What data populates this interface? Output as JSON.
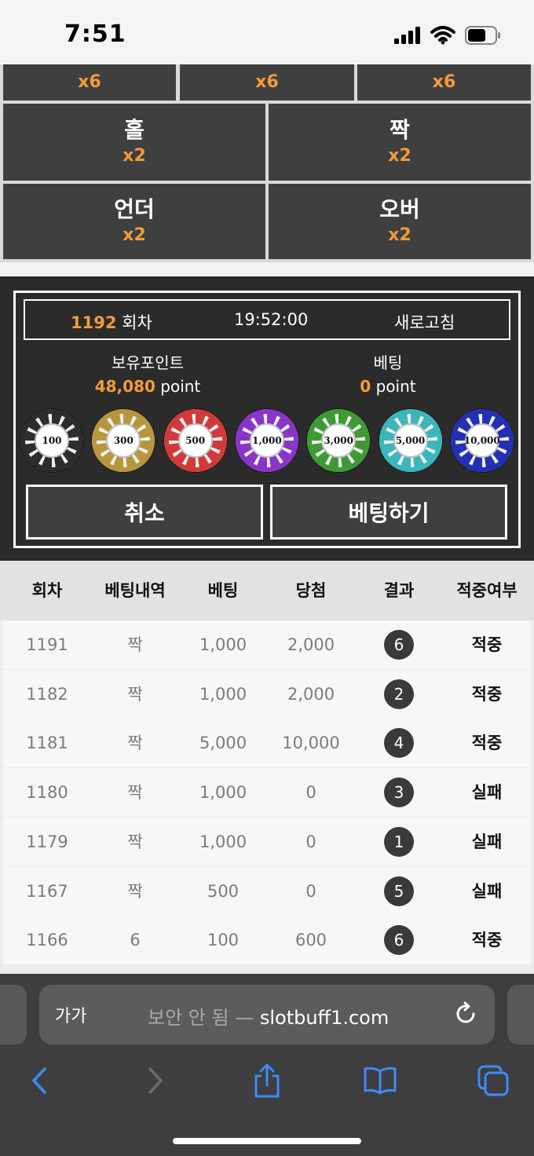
{
  "status_bar": {
    "time": "7:51"
  },
  "bet_grid": {
    "top_row": [
      {
        "odds": "x6"
      },
      {
        "odds": "x6"
      },
      {
        "odds": "x6"
      }
    ],
    "options": [
      {
        "label": "홀",
        "odds": "x2"
      },
      {
        "label": "짝",
        "odds": "x2"
      },
      {
        "label": "언더",
        "odds": "x2"
      },
      {
        "label": "오버",
        "odds": "x2"
      }
    ]
  },
  "panel": {
    "round_number": "1192",
    "round_suffix": " 회차",
    "time": "19:52:00",
    "refresh_label": "새로고침",
    "balance_label": "보유포인트",
    "balance_value": "48,080",
    "bet_label": "베팅",
    "bet_value": "0",
    "point_unit": " point",
    "chips": [
      {
        "label": "100",
        "color": "#2d2d2d"
      },
      {
        "label": "300",
        "color": "#b8963e"
      },
      {
        "label": "500",
        "color": "#d23a3a"
      },
      {
        "label": "1,000",
        "color": "#8a35c9"
      },
      {
        "label": "3,000",
        "color": "#3f9a36"
      },
      {
        "label": "5,000",
        "color": "#3cb5bd"
      },
      {
        "label": "10,000",
        "color": "#2430b4"
      }
    ],
    "cancel_label": "취소",
    "place_bet_label": "베팅하기"
  },
  "history": {
    "headers": [
      "회차",
      "베팅내역",
      "베팅",
      "당첨",
      "결과",
      "적중여부"
    ],
    "rows": [
      {
        "round": "1191",
        "pick": "짝",
        "bet": "1,000",
        "win": "2,000",
        "result": "6",
        "status": "적중"
      },
      {
        "round": "1182",
        "pick": "짝",
        "bet": "1,000",
        "win": "2,000",
        "result": "2",
        "status": "적중"
      },
      {
        "round": "1181",
        "pick": "짝",
        "bet": "5,000",
        "win": "10,000",
        "result": "4",
        "status": "적중"
      },
      {
        "round": "1180",
        "pick": "짝",
        "bet": "1,000",
        "win": "0",
        "result": "3",
        "status": "실패"
      },
      {
        "round": "1179",
        "pick": "짝",
        "bet": "1,000",
        "win": "0",
        "result": "1",
        "status": "실패"
      },
      {
        "round": "1167",
        "pick": "짝",
        "bet": "500",
        "win": "0",
        "result": "5",
        "status": "실패"
      },
      {
        "round": "1166",
        "pick": "6",
        "bet": "100",
        "win": "600",
        "result": "6",
        "status": "적중"
      }
    ]
  },
  "browser": {
    "text_size_label": "가가",
    "security_note": "보안 안 됨 — ",
    "domain": "slotbuff1.com"
  },
  "colors": {
    "accent": "#f39b3a",
    "tile": "#3f3f3f",
    "panel": "#2b2b2b"
  }
}
